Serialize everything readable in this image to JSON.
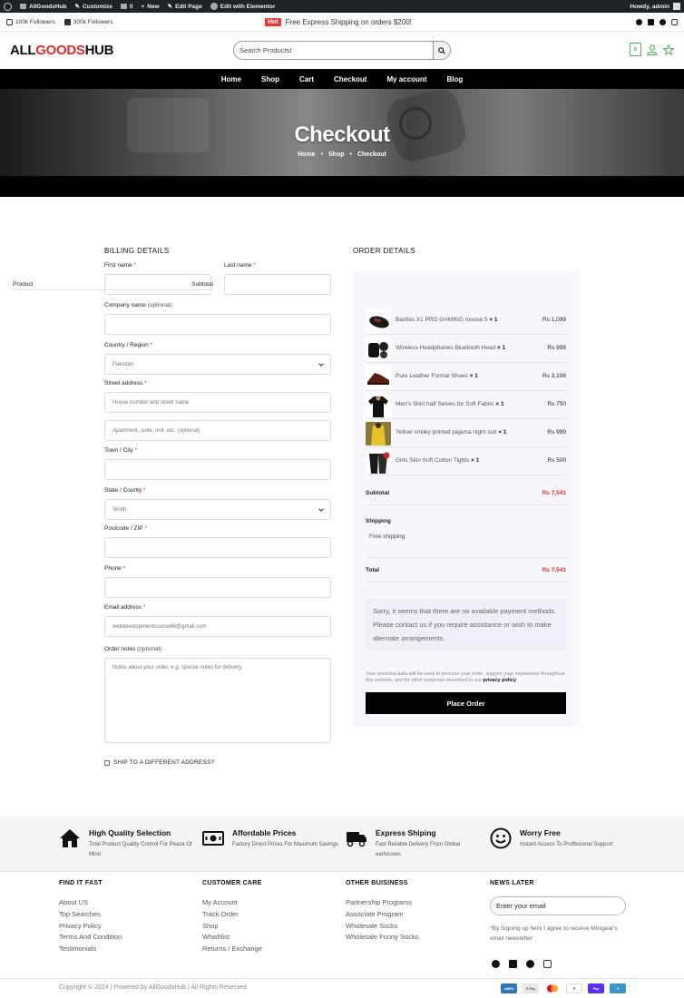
{
  "adminbar": {
    "site": "AllGoodsHub",
    "customize": "Customize",
    "comments": "0",
    "new": "New",
    "edit_page": "Edit Page",
    "elementor": "Edit with Elementor",
    "howdy": "Howdy, admin"
  },
  "topbar": {
    "instagram_followers": "100k Followers",
    "facebook_followers": "300k Followers",
    "hot": "Hot",
    "promo": "Free Express Shipping on orders $200!"
  },
  "header": {
    "logo_part1": "ALL",
    "logo_part2": "GOODS",
    "logo_part3": "HUB",
    "search_placeholder": "Search Products!",
    "cart_count": "6"
  },
  "nav": [
    "Home",
    "Shop",
    "Cart",
    "Checkout",
    "My account",
    "Blog"
  ],
  "hero": {
    "title": "Checkout",
    "crumbs": [
      "Home",
      "Shop",
      "Checkout"
    ],
    "sep": "•"
  },
  "billing": {
    "title": "BILLING DETAILS",
    "first_name": "First name",
    "last_name": "Last name",
    "company": "Company name",
    "optional": "(optional)",
    "country": "Country / Region",
    "country_value": "Pakistan",
    "street": "Street address",
    "street_ph1": "House number and street name",
    "street_ph2": "Apartment, suite, unit, etc. (optional)",
    "town": "Town / City",
    "state": "State / County",
    "state_value": "Sindh",
    "postcode": "Postcode / ZIP",
    "phone": "Phone",
    "email": "Email address",
    "email_value": "webdevelopmentcourse66@gmail.com",
    "notes": "Order notes",
    "notes_ph": "Notes about your order, e.g. special notes for delivery.",
    "ship_different": "SHIP TO A DIFFERENT ADDRESS?",
    "required_mark": "*"
  },
  "order": {
    "title": "ORDER DETAILS",
    "col_product": "Product",
    "col_subtotal": "Subtotal",
    "items": [
      {
        "name": "Bazllas X1 PRO GAMING mouse 5",
        "qty": "× 1",
        "price": "Rs 1,099"
      },
      {
        "name": "Wireless Headphones Bluetooth Head",
        "qty": "× 1",
        "price": "Rs 995"
      },
      {
        "name": "Pure Leather Formal Shoes",
        "qty": "× 1",
        "price": "Rs 3,198"
      },
      {
        "name": "Men's Shirt half Selves for Soft Fabric",
        "qty": "× 1",
        "price": "Rs 750"
      },
      {
        "name": "Yellow smiley printed pajama night suit",
        "qty": "× 1",
        "price": "Rs 999"
      },
      {
        "name": "Girls Skin Soft Cotton Tights",
        "qty": "× 1",
        "price": "Rs 500"
      }
    ],
    "subtotal_label": "Subtotal",
    "subtotal_value": "Rs 7,541",
    "shipping_label": "Shipping",
    "shipping_value": "Free shipping",
    "total_label": "Total",
    "total_value": "Rs 7,541",
    "notice": "Sorry, it seems that there are no available payment methods. Please contact us if you require assistance or wish to make alternate arrangements.",
    "privacy_text": "Your personal data will be used to process your order, support your experience throughout this website, and for other purposes described in our",
    "privacy_link": "privacy policy",
    "place_order": "Place Order"
  },
  "features": [
    {
      "icon": "home-icon",
      "title": "High Quality Selection",
      "desc": "Total Product Quality Control For Peace Of Mind"
    },
    {
      "icon": "money-icon",
      "title": "Affordable Prices",
      "desc": "Factory Direct Prices For Maximum Savings"
    },
    {
      "icon": "truck-icon",
      "title": "Express Shiping",
      "desc": "Fast Reliable Delivery From Global earhouses"
    },
    {
      "icon": "smile-icon",
      "title": "Worry Free",
      "desc": "Instant Access To Proffesional Support"
    }
  ],
  "footer": {
    "col1_title": "FIND IT FAST",
    "col1": [
      "About US",
      "Top Searches",
      "Privacy Policy",
      "Terms And Condition",
      "Testimonials"
    ],
    "col2_title": "CUSTOMER CARE",
    "col2": [
      "My Account",
      "Track Order",
      "Shop",
      "Whishlist",
      "Returns / Exchange"
    ],
    "col3_title": "OTHER BUISINESS",
    "col3": [
      "Partnership Programs",
      "Associate Program",
      "Wholesale Socks",
      "Wholesale Funny Socks"
    ],
    "col4_title": "NEWS LATER",
    "email_placeholder": "Enter your email",
    "note": "*By Signing up here I agree to receive Minigear's email newsletter",
    "copyright": "Copyright © 2024 | Powered by AllGoodsHub | All Rights Reserved",
    "payments": [
      "AMEX",
      "G Pay",
      "Mastercard",
      "PayPal",
      "Apple Pay",
      "Venmo"
    ]
  }
}
